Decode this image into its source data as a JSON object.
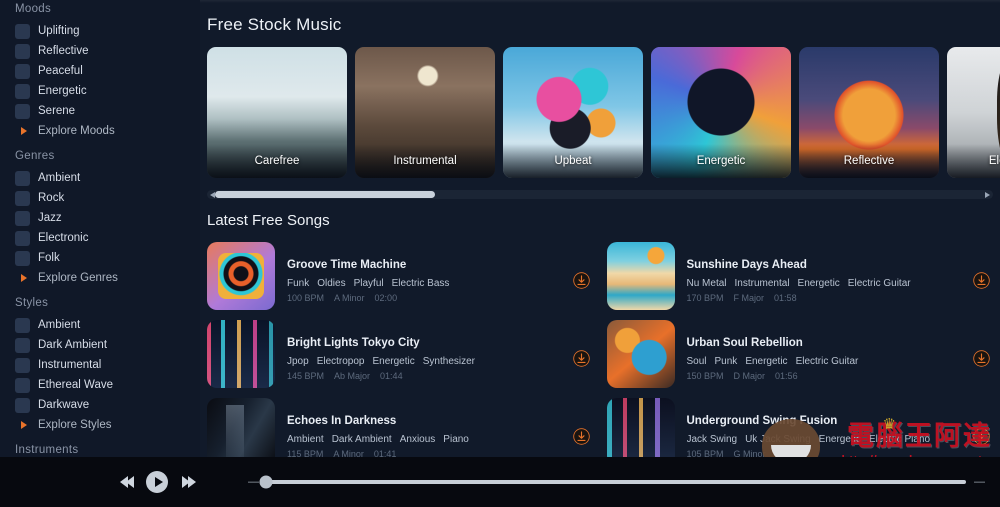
{
  "sidebar": {
    "sections": [
      {
        "name": "Moods",
        "heading": "Moods",
        "clipped": true,
        "items": [
          {
            "label": "Uplifting",
            "icon": "mood-thumb-uplifting",
            "art": "g-uplift"
          },
          {
            "label": "Reflective",
            "icon": "mood-thumb-reflective",
            "art": "g-reflect"
          },
          {
            "label": "Peaceful",
            "icon": "mood-thumb-peaceful",
            "art": "g-peace"
          },
          {
            "label": "Energetic",
            "icon": "mood-thumb-energetic",
            "art": "g-energet"
          },
          {
            "label": "Serene",
            "icon": "mood-thumb-serene",
            "art": "g-serene"
          }
        ],
        "explore": {
          "label": "Explore Moods",
          "icon": "play-triangle-icon"
        }
      },
      {
        "name": "Genres",
        "heading": "Genres",
        "clipped": false,
        "items": [
          {
            "label": "Ambient",
            "icon": "genre-thumb-ambient",
            "art": "g-ambient"
          },
          {
            "label": "Rock",
            "icon": "genre-thumb-rock",
            "art": "g-rock"
          },
          {
            "label": "Jazz",
            "icon": "genre-thumb-jazz",
            "art": "g-jazz"
          },
          {
            "label": "Electronic",
            "icon": "genre-thumb-electronic",
            "art": "g-electro"
          },
          {
            "label": "Folk",
            "icon": "genre-thumb-folk",
            "art": "g-folk"
          }
        ],
        "explore": {
          "label": "Explore Genres",
          "icon": "play-triangle-icon"
        }
      },
      {
        "name": "Styles",
        "heading": "Styles",
        "clipped": false,
        "items": [
          {
            "label": "Ambient",
            "icon": "style-thumb-ambient",
            "art": "g-ambient2"
          },
          {
            "label": "Dark Ambient",
            "icon": "style-thumb-dark-ambient",
            "art": "g-dark"
          },
          {
            "label": "Instrumental",
            "icon": "style-thumb-instrumental",
            "art": "g-instr"
          },
          {
            "label": "Ethereal Wave",
            "icon": "style-thumb-ethereal-wave",
            "art": "g-ether"
          },
          {
            "label": "Darkwave",
            "icon": "style-thumb-darkwave",
            "art": "g-darkw"
          }
        ],
        "explore": {
          "label": "Explore Styles",
          "icon": "play-triangle-icon"
        }
      },
      {
        "name": "Instruments",
        "heading": "Instruments",
        "clipped": false,
        "items": [],
        "explore": null
      }
    ]
  },
  "main": {
    "page_title": "Free Stock Music",
    "section_title": "Latest Free Songs",
    "cards": [
      {
        "label": "Carefree",
        "art": "a-carefree"
      },
      {
        "label": "Instrumental",
        "art": "a-instr"
      },
      {
        "label": "Upbeat",
        "art": "a-upbeat"
      },
      {
        "label": "Energetic",
        "art": "a-energetic"
      },
      {
        "label": "Reflective",
        "art": "a-reflective"
      },
      {
        "label": "Electric Gu",
        "art": "a-guitar"
      }
    ],
    "carousel_scrollbar": {
      "left_arrow": "scroll-left-arrow",
      "right_arrow": "scroll-right-arrow",
      "thumb_width_pct": 28
    },
    "songs": [
      {
        "title": "Groove Time Machine",
        "tags": [
          "Funk",
          "Oldies",
          "Playful",
          "Electric Bass"
        ],
        "bpm": "100 BPM",
        "key": "A Minor",
        "duration": "02:00",
        "art": "t-groove",
        "download_icon": "download-icon"
      },
      {
        "title": "Sunshine Days Ahead",
        "tags": [
          "Nu Metal",
          "Instrumental",
          "Energetic",
          "Electric Guitar"
        ],
        "bpm": "170 BPM",
        "key": "F Major",
        "duration": "01:58",
        "art": "t-sunshine",
        "download_icon": "download-icon"
      },
      {
        "title": "Bright Lights Tokyo City",
        "tags": [
          "Jpop",
          "Electropop",
          "Energetic",
          "Synthesizer"
        ],
        "bpm": "145 BPM",
        "key": "Ab Major",
        "duration": "01:44",
        "art": "t-tokyo",
        "download_icon": "download-icon"
      },
      {
        "title": "Urban Soul Rebellion",
        "tags": [
          "Soul",
          "Punk",
          "Energetic",
          "Electric Guitar"
        ],
        "bpm": "150 BPM",
        "key": "D Major",
        "duration": "01:56",
        "art": "t-urban",
        "download_icon": "download-icon"
      },
      {
        "title": "Echoes In Darkness",
        "tags": [
          "Ambient",
          "Dark Ambient",
          "Anxious",
          "Piano"
        ],
        "bpm": "115 BPM",
        "key": "A Minor",
        "duration": "01:41",
        "art": "t-echoes",
        "download_icon": "download-icon"
      },
      {
        "title": "Underground Swing Fusion",
        "tags": [
          "Jack Swing",
          "Uk Jack Swing",
          "Energetic",
          "Electric Piano"
        ],
        "bpm": "105 BPM",
        "key": "G Minor",
        "duration": "",
        "art": "t-under",
        "download_icon": "download-icon"
      }
    ]
  },
  "player": {
    "rewind_icon": "rewind-icon",
    "play_icon": "play-icon",
    "forward_icon": "fast-forward-icon",
    "seek_left_marker": "—",
    "seek_right_marker": "—",
    "seek_position_pct": 0
  },
  "watermark": {
    "text": "電腦王阿達",
    "url": "http://www.kocpc.com.tw"
  },
  "colors": {
    "background": "#0e1522",
    "sidebar": "#101828",
    "main": "#111a2a",
    "accent_orange": "#e8732a",
    "text_primary": "#e9eef5",
    "text_secondary": "#b9c3d1",
    "text_muted": "#5d6a7d",
    "player_bar": "#07090f",
    "watermark_red": "#cc1122"
  }
}
